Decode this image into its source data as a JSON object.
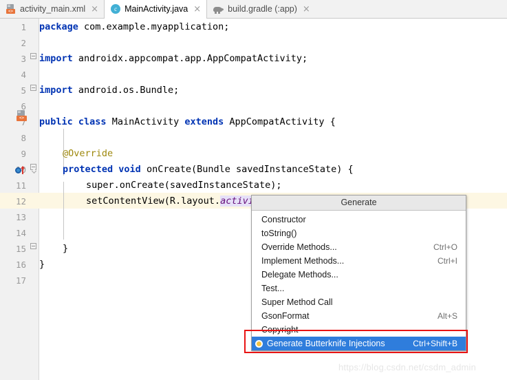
{
  "tabs": [
    {
      "label": "activity_main.xml",
      "icon": "xml-layout-icon",
      "active": false,
      "close": "×"
    },
    {
      "label": "MainActivity.java",
      "icon": "java-class-icon",
      "active": true,
      "close": "×"
    },
    {
      "label": "build.gradle (:app)",
      "icon": "gradle-icon",
      "active": false,
      "close": "×"
    }
  ],
  "editor": {
    "lines": [
      {
        "num": "1",
        "text": "package com.example.myapplication;"
      },
      {
        "num": "2",
        "text": ""
      },
      {
        "num": "3",
        "text": "import androidx.appcompat.app.AppCompatActivity;"
      },
      {
        "num": "4",
        "text": ""
      },
      {
        "num": "5",
        "text": "import android.os.Bundle;"
      },
      {
        "num": "6",
        "text": ""
      },
      {
        "num": "7",
        "text": "public class MainActivity extends AppCompatActivity {"
      },
      {
        "num": "8",
        "text": ""
      },
      {
        "num": "9",
        "text": "    @Override"
      },
      {
        "num": "10",
        "text": "    protected void onCreate(Bundle savedInstanceState) {"
      },
      {
        "num": "11",
        "text": "        super.onCreate(savedInstanceState);"
      },
      {
        "num": "12",
        "text": "        setContentView(R.layout.activity_main);"
      },
      {
        "num": "13",
        "text": ""
      },
      {
        "num": "14",
        "text": ""
      },
      {
        "num": "15",
        "text": "    }"
      },
      {
        "num": "16",
        "text": "}"
      },
      {
        "num": "17",
        "text": ""
      }
    ],
    "current_line": "12",
    "gutter_icons": [
      {
        "line": "7",
        "name": "related-layout-icon"
      },
      {
        "line": "10",
        "name": "overriding-method-icon"
      }
    ]
  },
  "code_tokens": {
    "l1_kw": "package",
    "l1_rest": " com.example.myapplication;",
    "l3_kw": "import",
    "l3_rest": " androidx.appcompat.app.AppCompatActivity;",
    "l5_kw": "import",
    "l5_rest": " android.os.Bundle;",
    "l7_kw1": "public",
    "l7_sp1": " ",
    "l7_kw2": "class",
    "l7_mid": " MainActivity ",
    "l7_kw3": "extends",
    "l7_rest": " AppCompatActivity {",
    "l9_ann": "@Override",
    "l10_kw1": "protected",
    "l10_sp": " ",
    "l10_kw2": "void",
    "l10_rest": " onCreate(Bundle savedInstanceState) {",
    "l11_text": "super.onCreate(savedInstanceState);",
    "l12_pre": "setContentView(R.layout.",
    "l12_fld": "activity_main",
    "l12_post": ");",
    "l15_text": "}",
    "l16_text": "}"
  },
  "popup": {
    "title": "Generate",
    "items": [
      {
        "label": "Constructor",
        "shortcut": "",
        "selected": false,
        "bullet": false
      },
      {
        "label": "toString()",
        "shortcut": "",
        "selected": false,
        "bullet": false
      },
      {
        "label": "Override Methods...",
        "shortcut": "Ctrl+O",
        "selected": false,
        "bullet": false
      },
      {
        "label": "Implement Methods...",
        "shortcut": "Ctrl+I",
        "selected": false,
        "bullet": false
      },
      {
        "label": "Delegate Methods...",
        "shortcut": "",
        "selected": false,
        "bullet": false
      },
      {
        "label": "Test...",
        "shortcut": "",
        "selected": false,
        "bullet": false
      },
      {
        "label": "Super Method Call",
        "shortcut": "",
        "selected": false,
        "bullet": false
      },
      {
        "label": "GsonFormat",
        "shortcut": "Alt+S",
        "selected": false,
        "bullet": false
      },
      {
        "label": "Copyright",
        "shortcut": "",
        "selected": false,
        "bullet": false
      },
      {
        "label": "Generate Butterknife Injections",
        "shortcut": "Ctrl+Shift+B",
        "selected": true,
        "bullet": true
      }
    ]
  },
  "annotation": {
    "name": "red-highlight-box",
    "color": "#e81313"
  },
  "watermark": "https://blog.csdn.net/csdm_admin"
}
